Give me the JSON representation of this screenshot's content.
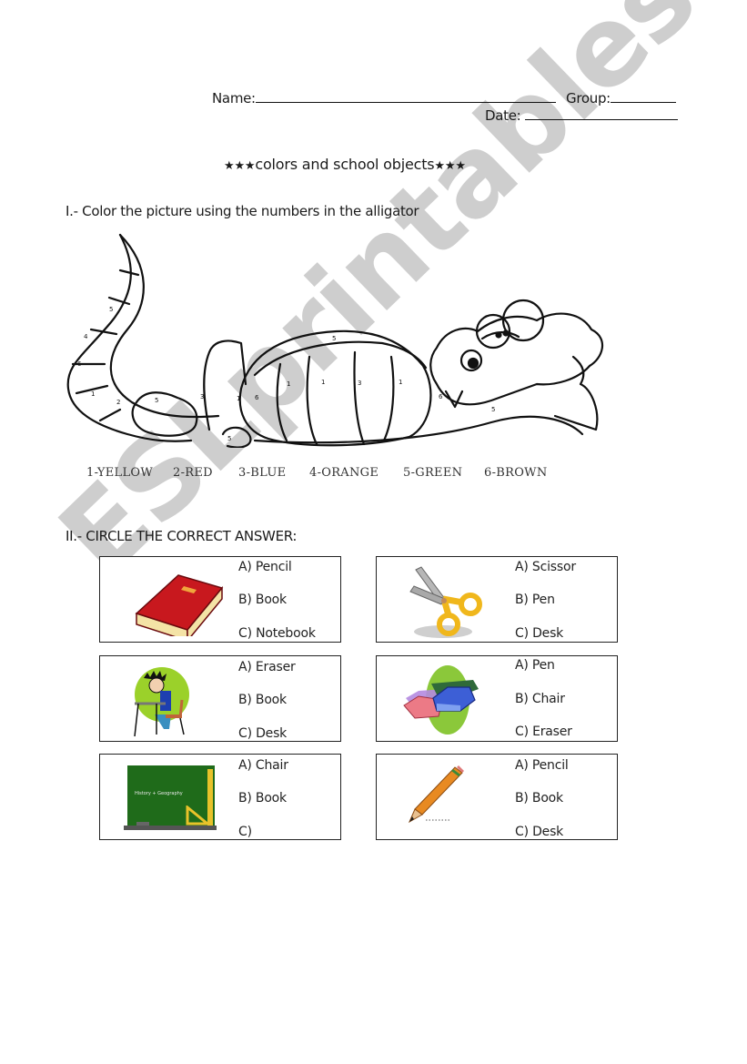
{
  "header": {
    "name_label": "Name:",
    "group_label": "Group:",
    "date_label": "Date:"
  },
  "title": {
    "stars_left": "★★★",
    "text": "colors and school objects",
    "stars_right": "★★★"
  },
  "section1": {
    "instruction": "I.- Color the picture using the numbers in the alligator",
    "picture": "alligator-coloring-picture",
    "color_key": [
      {
        "number": "1",
        "label": "1-YELLOW",
        "color": "#f5d90a"
      },
      {
        "number": "2",
        "label": "2-RED",
        "color": "#d62828"
      },
      {
        "number": "3",
        "label": "3-BLUE",
        "color": "#1f5fd1"
      },
      {
        "number": "4",
        "label": "4-ORANGE",
        "color": "#f08a12"
      },
      {
        "number": "5",
        "label": "5-GREEN",
        "color": "#3aa33a"
      },
      {
        "number": "6",
        "label": "6-BROWN",
        "color": "#7a4a1f"
      }
    ]
  },
  "section2": {
    "instruction": "II.- CIRCLE THE CORRECT ANSWER:",
    "questions": [
      {
        "picture": "book",
        "options": [
          "A)  Pencil",
          "B)  Book",
          "C) Notebook"
        ]
      },
      {
        "picture": "scissors",
        "options": [
          "A)  Scissor",
          "B)  Pen",
          "C) Desk"
        ]
      },
      {
        "picture": "student-at-desk",
        "options": [
          "A)  Eraser",
          "B)  Book",
          "C)  Desk"
        ]
      },
      {
        "picture": "eraser",
        "options": [
          "A)  Pen",
          "B)  Chair",
          "C) Eraser"
        ]
      },
      {
        "picture": "chalkboard",
        "chalkboard_text": "History + Geography",
        "options": [
          "A)  Chair",
          "B)  Book",
          "C)"
        ]
      },
      {
        "picture": "pencil",
        "options": [
          "A)  Pencil",
          "B)  Book",
          "C)  Desk"
        ]
      }
    ]
  },
  "watermark": "ESLprintables.com"
}
